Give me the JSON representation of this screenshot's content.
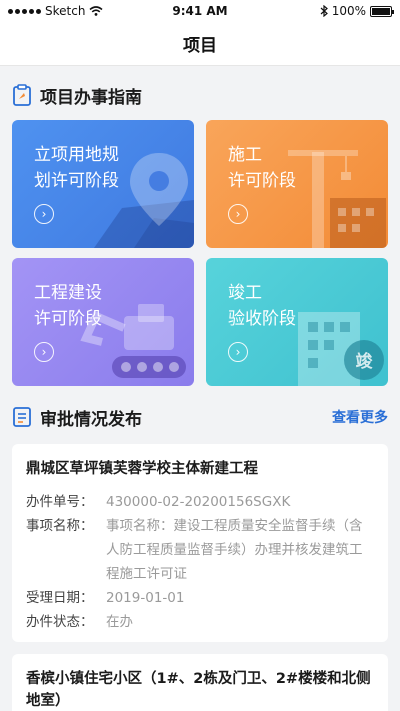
{
  "status_bar": {
    "carrier": "Sketch",
    "time": "9:41 AM",
    "battery": "100%",
    "battery_level": 1.0
  },
  "nav": {
    "title": "项目"
  },
  "guide": {
    "title": "项目办事指南",
    "cards": [
      {
        "label": "立项用地规\n划许可阶段"
      },
      {
        "label": "施工\n许可阶段"
      },
      {
        "label": "工程建设\n许可阶段"
      },
      {
        "label": "竣工\n验收阶段",
        "badge": "竣"
      }
    ]
  },
  "approval": {
    "title": "审批情况发布",
    "more": "查看更多",
    "items": [
      {
        "title": "鼎城区草坪镇芙蓉学校主体新建工程",
        "fields": [
          {
            "key": "办件单号：",
            "value": "430000-02-20200156SGXK"
          },
          {
            "key": "事项名称：",
            "value": "事项名称：建设工程质量安全监督手续（含人防工程质量监督手续）办理并核发建筑工程施工许可证"
          },
          {
            "key": "受理日期：",
            "value": "2019-01-01"
          },
          {
            "key": "办件状态：",
            "value": "在办"
          }
        ]
      },
      {
        "title": "香槟小镇住宅小区（1#、2栋及门卫、2#楼楼和北侧地室）"
      }
    ]
  },
  "colors": {
    "accent": "#2a6fd6",
    "card1": "#4f92f0",
    "card2": "#f9a55a",
    "card3": "#a394f5",
    "card4": "#57d3db"
  }
}
